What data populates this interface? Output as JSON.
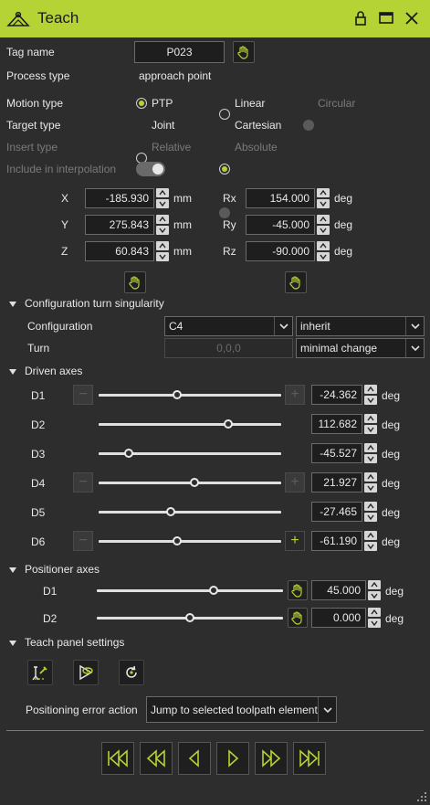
{
  "window": {
    "title": "Teach"
  },
  "general": {
    "tag_name_label": "Tag name",
    "tag_name_value": "P023",
    "process_type_label": "Process type",
    "process_type_value": "approach point",
    "motion_type_label": "Motion type",
    "motion_options": [
      "PTP",
      "Linear",
      "Circular"
    ],
    "target_type_label": "Target type",
    "target_options": [
      "Joint",
      "Cartesian"
    ],
    "insert_type_label": "Insert type",
    "insert_options": [
      "Relative",
      "Absolute"
    ],
    "interp_label": "Include in interpolation"
  },
  "coords": {
    "x_label": "X",
    "x_value": "-185.930",
    "x_unit": "mm",
    "y_label": "Y",
    "y_value": "275.843",
    "y_unit": "mm",
    "z_label": "Z",
    "z_value": "60.843",
    "z_unit": "mm",
    "rx_label": "Rx",
    "rx_value": "154.000",
    "rx_unit": "deg",
    "ry_label": "Ry",
    "ry_value": "-45.000",
    "ry_unit": "deg",
    "rz_label": "Rz",
    "rz_value": "-90.000",
    "rz_unit": "deg"
  },
  "config": {
    "section": "Configuration turn singularity",
    "configuration_label": "Configuration",
    "configuration_value": "C4",
    "configuration_mode": "inherit",
    "turn_label": "Turn",
    "turn_value": "0,0,0",
    "turn_mode": "minimal change"
  },
  "driven": {
    "section": "Driven axes",
    "axes": [
      {
        "label": "D1",
        "value": "-24.362",
        "unit": "deg",
        "pos": 0.43
      },
      {
        "label": "D2",
        "value": "112.682",
        "unit": "deg",
        "pos": 0.71
      },
      {
        "label": "D3",
        "value": "-45.527",
        "unit": "deg",
        "pos": 0.165
      },
      {
        "label": "D4",
        "value": "21.927",
        "unit": "deg",
        "pos": 0.525
      },
      {
        "label": "D5",
        "value": "-27.465",
        "unit": "deg",
        "pos": 0.395
      },
      {
        "label": "D6",
        "value": "-61.190",
        "unit": "deg",
        "pos": 0.43
      }
    ]
  },
  "positioner": {
    "section": "Positioner axes",
    "axes": [
      {
        "label": "D1",
        "value": "45.000",
        "unit": "deg",
        "pos": 0.625
      },
      {
        "label": "D2",
        "value": "0.000",
        "unit": "deg",
        "pos": 0.5
      }
    ]
  },
  "teach_settings": {
    "section": "Teach panel settings",
    "error_label": "Positioning error action",
    "error_value": "Jump to selected toolpath element"
  },
  "colors": {
    "accent": "#b5d334",
    "background": "#2d2d2d"
  }
}
